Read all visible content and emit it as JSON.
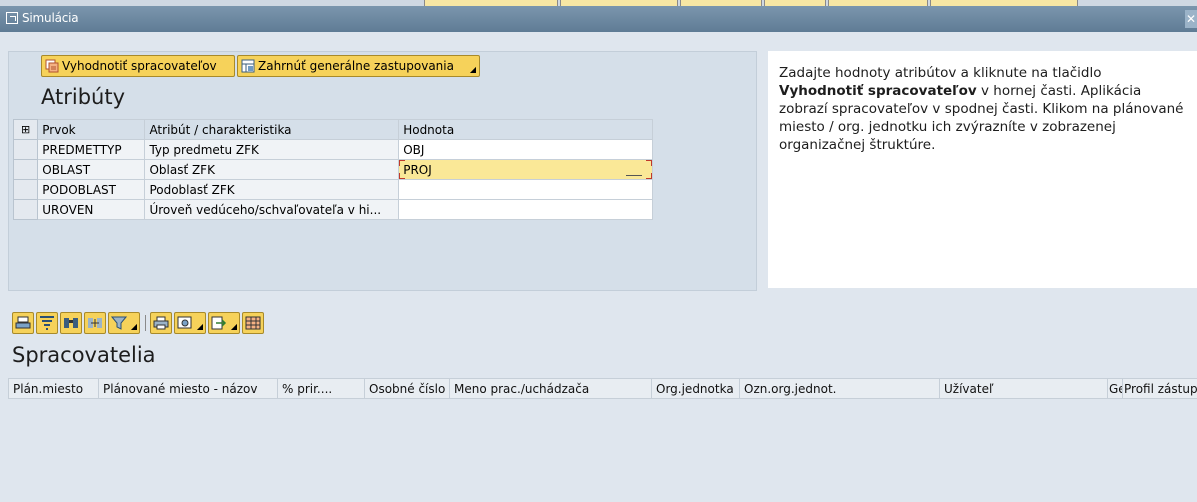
{
  "window": {
    "title": "Simulácia"
  },
  "toolbar_top": {
    "evaluate_label": "Vyhodnotiť spracovateľov",
    "include_label": "Zahrnúť generálne zastupovania"
  },
  "attributes": {
    "title": "Atribúty",
    "columns": [
      "Prvok",
      "Atribút / charakteristika",
      "Hodnota"
    ],
    "rows": [
      {
        "key": "PREDMETTYP",
        "attr": "Typ predmetu ZFK",
        "value": "OBJ"
      },
      {
        "key": "OBLAST",
        "attr": "Oblasť ZFK",
        "value": "PROJ"
      },
      {
        "key": "PODOBLAST",
        "attr": "Podoblasť ZFK",
        "value": ""
      },
      {
        "key": "UROVEN",
        "attr": "Úroveň vedúceho/schvaľovateľa v hi...",
        "value": ""
      }
    ]
  },
  "info": {
    "text_before": "Zadajte hodnoty atribútov a kliknute na tlačidlo ",
    "text_bold": "Vyhodnotiť spracovateľov",
    "text_after": " v hornej časti. Aplikácia zobrazí spracovateľov v spodnej časti. Klikom na plánované miesto / org. jednotku ich zvýrazníte v zobrazenej organizačnej štruktúre."
  },
  "results": {
    "title": "Spracovatelia",
    "columns": [
      "Plán.miesto",
      "Plánované miesto - názov",
      "% prir....",
      "Osobné číslo",
      "Meno prac./uchádzača",
      "Org.jednotka",
      "Ozn.org.jednot.",
      "Užívateľ",
      "Ge",
      "Profil zástupcov"
    ]
  },
  "icons": {
    "evaluate": "evaluate-icon",
    "include": "include-substitutes-icon",
    "toolbar": [
      "details-icon",
      "filter-icon",
      "find-icon",
      "find-next-icon",
      "sort-filter-icon",
      "print-icon",
      "view-icon",
      "export-icon",
      "layout-icon"
    ]
  },
  "colors": {
    "accent": "#f6d25a",
    "titlebar": "#6a879f",
    "active_cell": "#fae897"
  }
}
